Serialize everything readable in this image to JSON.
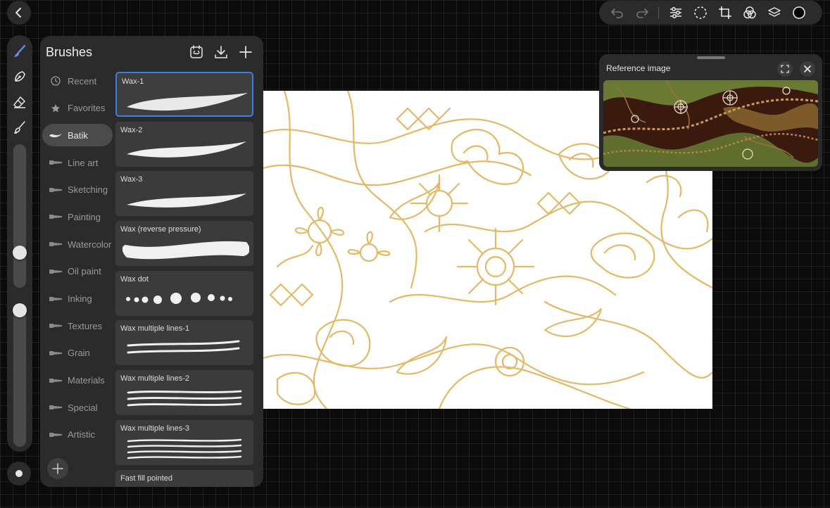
{
  "panel": {
    "title": "Brushes",
    "categories": [
      {
        "label": "Recent",
        "icon": "clock-icon"
      },
      {
        "label": "Favorites",
        "icon": "star-icon"
      },
      {
        "label": "Batik",
        "icon": "wave-brush-icon",
        "active": true
      },
      {
        "label": "Line art",
        "icon": "pen-brush-icon"
      },
      {
        "label": "Sketching",
        "icon": "pencil-brush-icon"
      },
      {
        "label": "Painting",
        "icon": "paint-brush-icon"
      },
      {
        "label": "Watercolor",
        "icon": "watercolor-brush-icon"
      },
      {
        "label": "Oil paint",
        "icon": "oil-brush-icon"
      },
      {
        "label": "Inking",
        "icon": "ink-brush-icon"
      },
      {
        "label": "Textures",
        "icon": "texture-brush-icon"
      },
      {
        "label": "Grain",
        "icon": "grain-brush-icon"
      },
      {
        "label": "Materials",
        "icon": "material-brush-icon"
      },
      {
        "label": "Special",
        "icon": "leaf-brush-icon"
      },
      {
        "label": "Artistic",
        "icon": "artistic-brush-icon"
      }
    ],
    "brushes": [
      {
        "name": "Wax-1",
        "selected": true
      },
      {
        "name": "Wax-2"
      },
      {
        "name": "Wax-3"
      },
      {
        "name": "Wax (reverse pressure)"
      },
      {
        "name": "Wax dot"
      },
      {
        "name": "Wax multiple lines-1"
      },
      {
        "name": "Wax multiple lines-2"
      },
      {
        "name": "Wax multiple lines-3"
      },
      {
        "name": "Fast fill pointed"
      }
    ]
  },
  "reference": {
    "title": "Reference image"
  },
  "rail": {
    "size_level": 0.78,
    "opacity_level": 0.0
  },
  "colors": {
    "accent": "#3d7de0",
    "batik_line": "#e3b867",
    "current_color": "#000000"
  }
}
